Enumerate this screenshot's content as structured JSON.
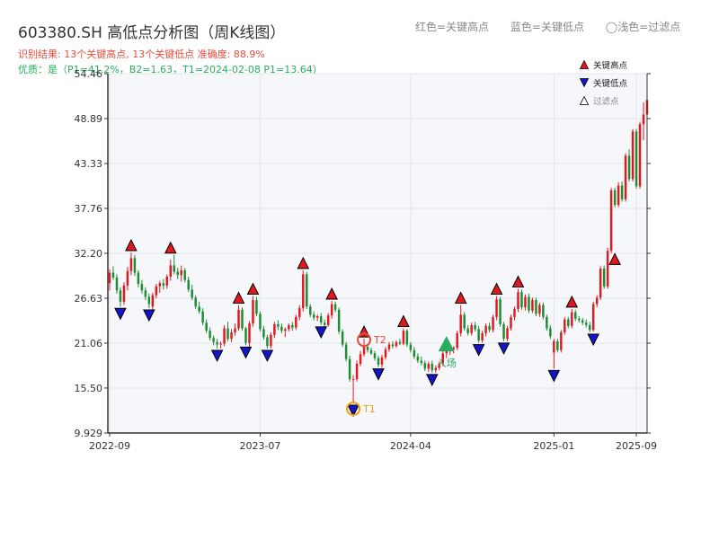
{
  "chart_data": {
    "type": "candlestick",
    "title": "603380.SH 高低点分析图（周K线图）",
    "legend_top": [
      "红色=关键高点",
      "蓝色=关键低点",
      "◯浅色=过滤点"
    ],
    "result_text": "识别结果: 13个关键高点, 13个关键低点   准确度: 88.9%",
    "quality_text": "优质：是（P1=41.2%，B2=1.63，T1=2024-02-08 P1=13.64）",
    "legend": {
      "items": [
        "关键高点",
        "关键低点",
        "过滤点"
      ],
      "placement": "top-right"
    },
    "y_ticks": [
      "54.46",
      "48.89",
      "43.33",
      "37.76",
      "32.20",
      "26.63",
      "21.06",
      "15.50",
      "9.929"
    ],
    "x_ticks": [
      "2022-09",
      "2023-07",
      "2024-04",
      "2025-01",
      "2025-09"
    ],
    "ylim": [
      9.929,
      54.46
    ],
    "grid": true,
    "candles_ohlc": [
      [
        28.5,
        30.2,
        27.6,
        29.8
      ],
      [
        29.8,
        30.6,
        28.9,
        29.2
      ],
      [
        29.2,
        29.6,
        27.2,
        27.6
      ],
      [
        27.6,
        28.0,
        25.6,
        26.2
      ],
      [
        26.2,
        28.6,
        25.8,
        28.2
      ],
      [
        28.2,
        30.5,
        27.6,
        30.0
      ],
      [
        30.0,
        32.3,
        29.5,
        31.6
      ],
      [
        31.6,
        32.0,
        29.4,
        29.8
      ],
      [
        29.8,
        30.1,
        28.0,
        28.4
      ],
      [
        28.4,
        28.9,
        27.2,
        27.6
      ],
      [
        27.6,
        28.0,
        26.4,
        26.8
      ],
      [
        26.8,
        27.2,
        25.4,
        25.9
      ],
      [
        25.6,
        27.3,
        25.2,
        27.0
      ],
      [
        27.0,
        28.4,
        26.6,
        28.1
      ],
      [
        28.1,
        28.8,
        27.3,
        28.5
      ],
      [
        28.5,
        29.0,
        27.7,
        28.2
      ],
      [
        28.2,
        29.6,
        27.8,
        29.3
      ],
      [
        29.3,
        31.4,
        28.8,
        30.7
      ],
      [
        30.7,
        32.0,
        29.6,
        29.9
      ],
      [
        29.9,
        30.4,
        29.0,
        29.5
      ],
      [
        29.5,
        30.7,
        28.7,
        30.1
      ],
      [
        30.1,
        30.4,
        28.6,
        28.9
      ],
      [
        28.9,
        29.3,
        27.4,
        27.7
      ],
      [
        27.7,
        28.3,
        26.4,
        26.7
      ],
      [
        26.7,
        27.0,
        25.3,
        25.6
      ],
      [
        25.6,
        26.2,
        24.7,
        25.0
      ],
      [
        25.0,
        25.4,
        23.3,
        23.6
      ],
      [
        23.6,
        24.0,
        22.3,
        22.6
      ],
      [
        22.6,
        23.0,
        21.4,
        21.7
      ],
      [
        21.7,
        22.0,
        20.8,
        21.2
      ],
      [
        21.2,
        21.6,
        20.4,
        20.9
      ],
      [
        20.9,
        21.3,
        20.4,
        21.0
      ],
      [
        21.0,
        23.3,
        20.7,
        22.9
      ],
      [
        22.9,
        23.7,
        21.3,
        21.6
      ],
      [
        21.6,
        22.8,
        21.2,
        22.4
      ],
      [
        22.4,
        23.5,
        22.0,
        22.9
      ],
      [
        22.9,
        25.8,
        22.6,
        25.2
      ],
      [
        25.2,
        25.5,
        22.6,
        22.9
      ],
      [
        22.9,
        23.1,
        20.8,
        21.1
      ],
      [
        21.1,
        23.8,
        20.6,
        23.5
      ],
      [
        23.5,
        26.9,
        23.1,
        26.4
      ],
      [
        26.4,
        26.8,
        24.4,
        24.7
      ],
      [
        24.7,
        25.0,
        22.5,
        22.8
      ],
      [
        22.8,
        23.2,
        21.5,
        21.8
      ],
      [
        21.8,
        22.1,
        20.4,
        20.7
      ],
      [
        20.7,
        22.4,
        20.4,
        22.1
      ],
      [
        22.1,
        23.7,
        21.7,
        23.4
      ],
      [
        23.4,
        23.9,
        22.7,
        23.1
      ],
      [
        23.1,
        23.5,
        22.3,
        22.6
      ],
      [
        22.6,
        23.0,
        21.8,
        22.8
      ],
      [
        22.8,
        23.5,
        22.5,
        23.3
      ],
      [
        23.3,
        23.7,
        22.6,
        23.0
      ],
      [
        23.0,
        24.6,
        22.7,
        24.3
      ],
      [
        24.3,
        25.8,
        23.9,
        25.4
      ],
      [
        25.4,
        30.1,
        25.0,
        29.6
      ],
      [
        29.6,
        29.9,
        25.3,
        25.6
      ],
      [
        25.6,
        25.9,
        24.3,
        24.6
      ],
      [
        24.6,
        25.0,
        23.9,
        24.2
      ],
      [
        24.2,
        24.6,
        23.8,
        24.4
      ],
      [
        24.4,
        24.8,
        23.3,
        23.6
      ],
      [
        23.6,
        24.0,
        23.0,
        23.3
      ],
      [
        23.3,
        24.8,
        23.1,
        24.5
      ],
      [
        24.5,
        26.3,
        24.1,
        25.9
      ],
      [
        25.9,
        26.2,
        24.9,
        25.2
      ],
      [
        25.2,
        25.5,
        22.2,
        22.5
      ],
      [
        22.5,
        22.8,
        20.6,
        20.9
      ],
      [
        20.9,
        21.2,
        18.8,
        19.1
      ],
      [
        19.1,
        19.5,
        16.3,
        16.6
      ],
      [
        16.6,
        17.1,
        13.6,
        16.6
      ],
      [
        16.6,
        18.9,
        16.3,
        18.5
      ],
      [
        18.5,
        20.1,
        18.2,
        19.7
      ],
      [
        19.7,
        21.6,
        19.4,
        20.6
      ],
      [
        20.6,
        20.9,
        19.9,
        20.2
      ],
      [
        20.2,
        20.5,
        19.6,
        19.8
      ],
      [
        19.8,
        20.1,
        18.9,
        19.2
      ],
      [
        19.2,
        19.5,
        18.1,
        18.4
      ],
      [
        18.4,
        19.6,
        18.0,
        19.3
      ],
      [
        19.3,
        20.6,
        19.0,
        20.3
      ],
      [
        20.3,
        21.2,
        20.0,
        20.9
      ],
      [
        20.9,
        21.3,
        20.4,
        20.7
      ],
      [
        20.7,
        21.4,
        20.5,
        21.2
      ],
      [
        21.2,
        21.6,
        20.8,
        21.0
      ],
      [
        21.0,
        22.9,
        20.8,
        22.6
      ],
      [
        22.6,
        22.8,
        20.6,
        20.9
      ],
      [
        20.9,
        21.2,
        19.9,
        20.2
      ],
      [
        20.2,
        20.6,
        19.1,
        19.4
      ],
      [
        19.4,
        19.8,
        18.6,
        18.9
      ],
      [
        18.9,
        19.4,
        18.3,
        18.6
      ],
      [
        18.6,
        18.9,
        17.6,
        17.9
      ],
      [
        17.9,
        18.8,
        17.5,
        18.5
      ],
      [
        18.5,
        18.9,
        17.4,
        17.7
      ],
      [
        17.7,
        18.3,
        17.4,
        18.0
      ],
      [
        18.0,
        18.8,
        17.7,
        18.5
      ],
      [
        18.5,
        20.1,
        18.2,
        19.8
      ],
      [
        19.8,
        20.4,
        19.2,
        20.1
      ],
      [
        20.1,
        20.6,
        19.6,
        20.3
      ],
      [
        20.3,
        20.7,
        19.8,
        20.5
      ],
      [
        20.5,
        22.6,
        20.2,
        22.3
      ],
      [
        22.3,
        25.8,
        21.9,
        24.6
      ],
      [
        24.6,
        24.9,
        22.6,
        22.9
      ],
      [
        22.9,
        23.3,
        22.0,
        22.3
      ],
      [
        22.3,
        23.6,
        22.0,
        23.3
      ],
      [
        23.3,
        23.7,
        22.5,
        22.8
      ],
      [
        22.8,
        23.2,
        21.1,
        21.4
      ],
      [
        21.4,
        22.6,
        21.1,
        22.3
      ],
      [
        22.3,
        23.5,
        21.9,
        23.2
      ],
      [
        23.2,
        23.6,
        22.4,
        22.7
      ],
      [
        22.7,
        24.6,
        22.4,
        24.3
      ],
      [
        24.3,
        26.9,
        23.9,
        26.5
      ],
      [
        26.5,
        26.8,
        23.1,
        23.4
      ],
      [
        23.4,
        23.7,
        21.3,
        21.6
      ],
      [
        21.6,
        23.2,
        21.3,
        22.9
      ],
      [
        22.9,
        24.6,
        22.6,
        24.3
      ],
      [
        24.3,
        25.6,
        23.9,
        25.3
      ],
      [
        25.3,
        27.8,
        24.9,
        27.4
      ],
      [
        27.4,
        27.7,
        25.2,
        25.5
      ],
      [
        25.5,
        27.1,
        25.1,
        26.8
      ],
      [
        26.8,
        27.2,
        24.8,
        25.1
      ],
      [
        25.1,
        26.7,
        24.8,
        26.4
      ],
      [
        26.4,
        26.7,
        24.4,
        24.7
      ],
      [
        24.7,
        26.1,
        24.3,
        25.8
      ],
      [
        25.8,
        26.1,
        24.0,
        24.3
      ],
      [
        24.3,
        24.6,
        22.6,
        22.9
      ],
      [
        22.9,
        23.3,
        21.6,
        21.9
      ],
      [
        19.9,
        21.6,
        17.9,
        21.3
      ],
      [
        21.3,
        21.6,
        19.9,
        20.2
      ],
      [
        20.2,
        22.7,
        19.9,
        22.4
      ],
      [
        22.4,
        24.3,
        22.1,
        24.0
      ],
      [
        24.0,
        24.3,
        22.9,
        23.2
      ],
      [
        23.2,
        25.3,
        22.9,
        24.9
      ],
      [
        24.9,
        25.2,
        23.8,
        24.1
      ],
      [
        24.1,
        24.4,
        23.6,
        23.9
      ],
      [
        23.9,
        24.2,
        23.3,
        23.6
      ],
      [
        23.6,
        24.0,
        23.0,
        23.3
      ],
      [
        23.3,
        23.7,
        22.4,
        22.7
      ],
      [
        22.7,
        26.2,
        22.5,
        25.9
      ],
      [
        25.9,
        27.0,
        25.5,
        26.7
      ],
      [
        26.7,
        30.6,
        26.4,
        30.3
      ],
      [
        30.3,
        30.7,
        27.8,
        28.1
      ],
      [
        28.1,
        32.9,
        27.8,
        32.5
      ],
      [
        32.5,
        40.3,
        32.2,
        40.0
      ],
      [
        40.0,
        40.3,
        37.9,
        38.2
      ],
      [
        38.2,
        41.0,
        37.9,
        40.6
      ],
      [
        40.6,
        41.1,
        38.6,
        38.9
      ],
      [
        38.9,
        44.6,
        38.6,
        44.3
      ],
      [
        44.3,
        45.1,
        41.1,
        41.4
      ],
      [
        41.4,
        47.6,
        41.1,
        47.3
      ],
      [
        47.3,
        47.6,
        40.2,
        40.5
      ],
      [
        40.5,
        48.5,
        40.2,
        48.2
      ],
      [
        48.2,
        50.9,
        46.2,
        49.4
      ],
      [
        49.4,
        51.5,
        46.6,
        51.2
      ]
    ],
    "key_highs": [
      {
        "i": 6,
        "p": 32.3
      },
      {
        "i": 17,
        "p": 32.0
      },
      {
        "i": 36,
        "p": 25.8
      },
      {
        "i": 40,
        "p": 26.9
      },
      {
        "i": 54,
        "p": 30.1
      },
      {
        "i": 62,
        "p": 26.3
      },
      {
        "i": 71,
        "p": 21.6
      },
      {
        "i": 82,
        "p": 22.9
      },
      {
        "i": 98,
        "p": 25.8
      },
      {
        "i": 108,
        "p": 26.9
      },
      {
        "i": 114,
        "p": 27.8
      },
      {
        "i": 129,
        "p": 25.3
      },
      {
        "i": 141,
        "p": 30.6
      }
    ],
    "key_lows": [
      {
        "i": 3,
        "p": 25.6
      },
      {
        "i": 11,
        "p": 25.4
      },
      {
        "i": 30,
        "p": 20.4
      },
      {
        "i": 38,
        "p": 20.8
      },
      {
        "i": 44,
        "p": 20.4
      },
      {
        "i": 59,
        "p": 23.3
      },
      {
        "i": 68,
        "p": 13.6
      },
      {
        "i": 75,
        "p": 18.1
      },
      {
        "i": 90,
        "p": 17.4
      },
      {
        "i": 103,
        "p": 21.1
      },
      {
        "i": 110,
        "p": 21.3
      },
      {
        "i": 124,
        "p": 17.9
      },
      {
        "i": 135,
        "p": 22.4
      }
    ],
    "annotations": [
      {
        "label": "T1",
        "i": 68,
        "p": 13.6
      },
      {
        "label": "T2",
        "i": 71,
        "p": 21.6
      },
      {
        "label": "入场",
        "i": 94,
        "p": 20.6
      }
    ]
  },
  "colors": {
    "up": "#e1191e",
    "down": "#1e8c32",
    "high_marker": "#e1191e",
    "low_marker": "#1414c8",
    "filtered": "#ffffff",
    "t1": "#f0a010",
    "t2": "#e74c3c",
    "entry": "#27ae60",
    "plot_bg": "#f5f7fa"
  }
}
